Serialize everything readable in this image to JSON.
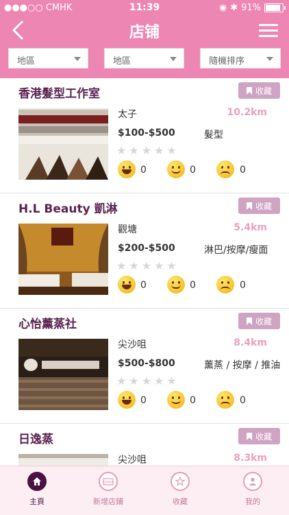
{
  "status": {
    "carrier": "●●●○○ CMHK",
    "time": "11:39",
    "battery": "91%",
    "battery_level": 0.91
  },
  "nav": {
    "title": "店铺"
  },
  "filters": [
    {
      "value": "地區"
    },
    {
      "value": "地區"
    },
    {
      "value": "隨機排序"
    }
  ],
  "fav_label": "收藏",
  "shops": [
    {
      "name": "香港髮型工作室",
      "district": "太子",
      "distance": "10.2km",
      "price": "$100-$500",
      "category": "髮型",
      "reactions": {
        "laugh": "0",
        "smile": "0",
        "sad": "0"
      }
    },
    {
      "name": "H.L Beauty 凱淋",
      "district": "觀塘",
      "distance": "5.4km",
      "price": "$200-$500",
      "category": "淋巴/按摩/瘦面",
      "reactions": {
        "laugh": "0",
        "smile": "0",
        "sad": "0"
      }
    },
    {
      "name": "心怡薰蒸社",
      "district": "尖沙咀",
      "distance": "8.4km",
      "price": "$500-$800",
      "category": "薰蒸 / 按摩 / 推油",
      "reactions": {
        "laugh": "0",
        "smile": "0",
        "sad": "0"
      }
    },
    {
      "name": "日逸蒸",
      "district": "尖沙咀",
      "distance": "8.3km",
      "price": "",
      "category": "",
      "reactions": {
        "laugh": "",
        "smile": "",
        "sad": ""
      }
    }
  ],
  "tabs": [
    {
      "label": "主頁",
      "icon": "home-icon",
      "active": true
    },
    {
      "label": "新增店鋪",
      "icon": "open-sign-icon",
      "active": false
    },
    {
      "label": "收藏",
      "icon": "star-icon",
      "active": false
    },
    {
      "label": "我的",
      "icon": "user-icon",
      "active": false
    }
  ],
  "colors": {
    "header": "#ee86b4",
    "fav_button": "#cfa3c2",
    "shop_name": "#5a2350",
    "distance": "#e9a0c0",
    "tab_active": "#4a1240"
  }
}
